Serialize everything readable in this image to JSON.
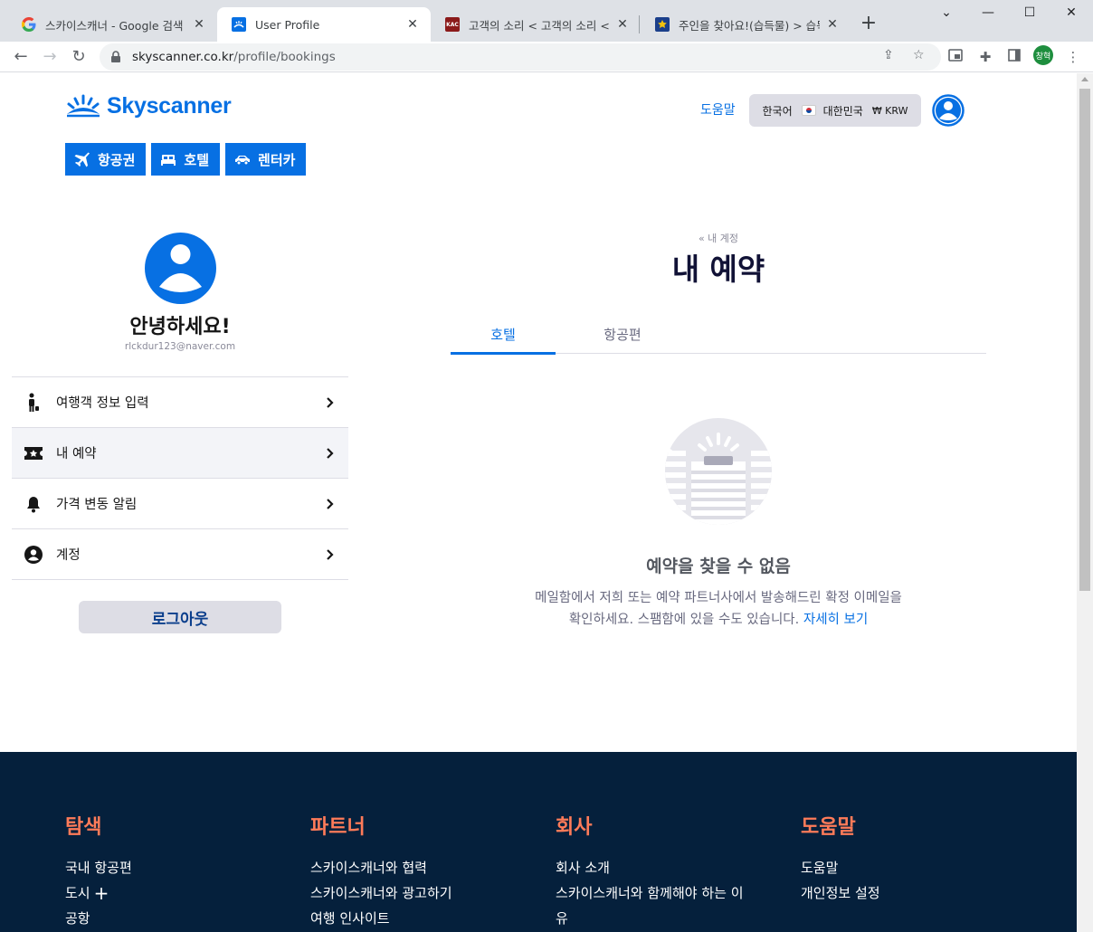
{
  "browser": {
    "tabs": [
      {
        "title": "스카이스캐너 - Google 검색",
        "favicon": "google-icon",
        "active": false
      },
      {
        "title": "User Profile",
        "favicon": "skyscanner-icon",
        "active": true
      },
      {
        "title": "고객의 소리 < 고객의 소리 < 고",
        "favicon": "kac-icon",
        "active": false
      },
      {
        "title": "주인을 찾아요!(습득물) > 습득",
        "favicon": "police-icon",
        "active": false
      }
    ],
    "url_host": "skyscanner.co.kr",
    "url_path": "/profile/bookings",
    "profile_initials": "창혁"
  },
  "header": {
    "logo_text": "Skyscanner",
    "help": "도움말",
    "language": "한국어",
    "country": "대한민국",
    "currency": "₩ KRW"
  },
  "nav": {
    "flights": "항공권",
    "hotels": "호텔",
    "cars": "렌터카"
  },
  "sidebar": {
    "greeting": "안녕하세요!",
    "email": "rlckdur123@naver.com",
    "items": [
      {
        "label": "여행객 정보 입력",
        "icon": "traveller-icon"
      },
      {
        "label": "내 예약",
        "icon": "ticket-icon"
      },
      {
        "label": "가격 변동 알림",
        "icon": "bell-icon"
      },
      {
        "label": "계정",
        "icon": "account-icon"
      }
    ],
    "logout": "로그아웃"
  },
  "main": {
    "breadcrumb": "« 내 계정",
    "title": "내 예약",
    "tabs": [
      "호텔",
      "항공편"
    ],
    "active_tab": "호텔",
    "empty_title": "예약을 찾을 수 없음",
    "empty_desc": "메일함에서 저희 또는 예약 파트너사에서 발송해드린 확정 이메일을 확인하세요. 스팸함에 있을 수도 있습니다.",
    "empty_link": "자세히 보기"
  },
  "footer": {
    "columns": [
      {
        "title": "탐색",
        "links": [
          "국내 항공편",
          "도시",
          "공항"
        ]
      },
      {
        "title": "파트너",
        "links": [
          "스카이스캐너와 협력",
          "스카이스캐너와 광고하기",
          "여행 인사이트"
        ]
      },
      {
        "title": "회사",
        "links": [
          "회사 소개",
          "스카이스캐너와 함께해야 하는 이",
          "유"
        ]
      },
      {
        "title": "도움말",
        "links": [
          "도움말",
          "개인정보 설정"
        ]
      }
    ]
  },
  "colors": {
    "brand": "#0770e3",
    "footer_bg": "#05203c",
    "footer_heading": "#ff7b59"
  }
}
